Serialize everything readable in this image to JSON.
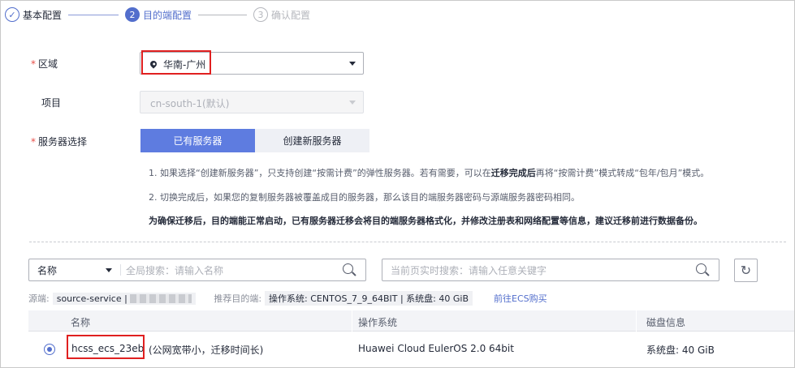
{
  "steps": [
    {
      "num": "✓",
      "label": "基本配置"
    },
    {
      "num": "2",
      "label": "目的端配置"
    },
    {
      "num": "3",
      "label": "确认配置"
    }
  ],
  "form": {
    "region": {
      "label": "区域",
      "value": "华南-广州"
    },
    "project": {
      "label": "项目",
      "value": "cn-south-1(默认)"
    },
    "server_select": {
      "label": "服务器选择",
      "options": [
        "已有服务器",
        "创建新服务器"
      ],
      "selected": "已有服务器"
    }
  },
  "notes": {
    "note1_pre": "1. 如果选择“创建新服务器”，只支持创建“按需计费”的弹性服务器。若有需要，可以在",
    "note1_bold": "迁移完成后",
    "note1_post": "再将“按需计费”模式转成“包年/包月”模式。",
    "note2": "2. 切换完成后，如果您的复制服务器被覆盖成目的服务器，那么该目的端服务器密码与源端服务器密码相同。",
    "warning": "为确保迁移后，目的端能正常启动，已有服务器迁移会将目的端服务器格式化，并修改注册表和网络配置等信息，建议迁移前进行数据备份。"
  },
  "search": {
    "filter_key": "名称",
    "global_placeholder": "全局搜索：请输入名称",
    "page_placeholder": "当前页实时搜索：请输入任意关键字"
  },
  "source_info": {
    "source_label": "源端:",
    "source_value": "source-service |",
    "recommend_label": "推荐目的端:",
    "recommend_value": "操作系统: CENTOS_7_9_64BIT | 系统盘: 40 GiB",
    "buy_link": "前往ECS购买"
  },
  "table": {
    "headers": [
      "名称",
      "操作系统",
      "磁盘信息"
    ],
    "rows": [
      {
        "name": "hcss_ecs_23eb",
        "name_note": "(公网宽带小，迁移时间长)",
        "os": "Huawei Cloud EulerOS 2.0 64bit",
        "disk": "系统盘: 40 GiB",
        "selected": true
      }
    ]
  },
  "colors": {
    "primary": "#526ecc",
    "button": "#5e7ce0",
    "highlight": "#e02020",
    "required": "#e84e48"
  }
}
